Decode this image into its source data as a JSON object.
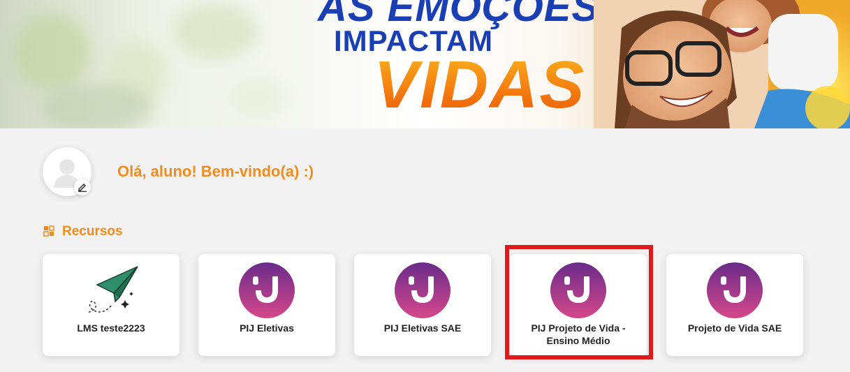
{
  "banner": {
    "line1": "AS EMOÇÕES",
    "line2": "IMPACTAM",
    "line3": "VIDAS"
  },
  "profile": {
    "greeting": "Olá, aluno! Bem-vindo(a) :)",
    "avatar_icon": "user-silhouette-icon",
    "edit_icon": "pencil-icon"
  },
  "resources": {
    "title": "Recursos",
    "icon": "grid-icon",
    "items": [
      {
        "label": "LMS teste2223",
        "icon": "paper-plane-icon"
      },
      {
        "label": "PIJ Eletivas",
        "icon": "smile-logo-icon"
      },
      {
        "label": "PIJ Eletivas SAE",
        "icon": "smile-logo-icon"
      },
      {
        "label": "PIJ Projeto de Vida - Ensino Médio",
        "icon": "smile-logo-icon",
        "highlighted": true
      },
      {
        "label": "Projeto de Vida SAE",
        "icon": "smile-logo-icon"
      }
    ]
  },
  "colors": {
    "accent_orange": "#f28c1c",
    "highlight_red": "#e01a1a",
    "logo_gradient_top": "#6a2b8a",
    "logo_gradient_bottom": "#d6488a"
  }
}
